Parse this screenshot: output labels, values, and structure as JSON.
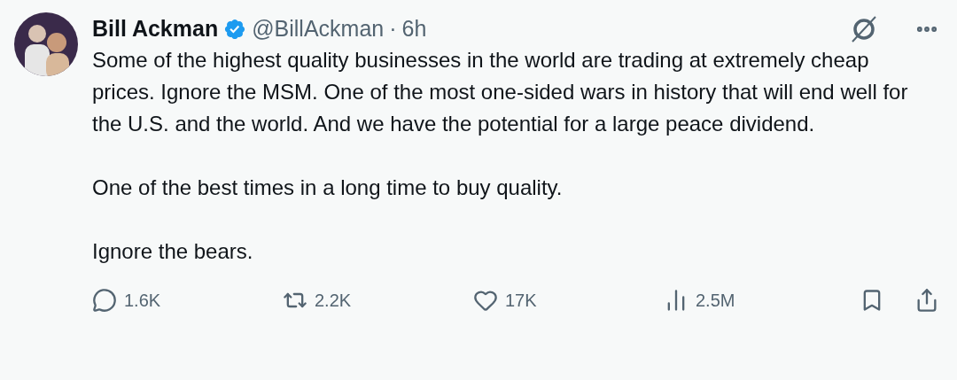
{
  "author": {
    "name": "Bill Ackman",
    "verified": true,
    "handle": "@BillAckman",
    "separator": "·",
    "time": "6h"
  },
  "paragraphs": [
    "Some of the highest quality businesses in the world are trading at extremely cheap prices. Ignore the MSM. One of the most one-sided wars in history that will end well for the U.S. and the world. And we have the potential for a large peace dividend.",
    "One of the best times in a long time to buy quality.",
    "Ignore the bears."
  ],
  "actions": [
    {
      "kind": "reply",
      "count": "1.6K"
    },
    {
      "kind": "repost",
      "count": "2.2K"
    },
    {
      "kind": "like",
      "count": "17K"
    },
    {
      "kind": "views",
      "count": "2.5M"
    }
  ]
}
